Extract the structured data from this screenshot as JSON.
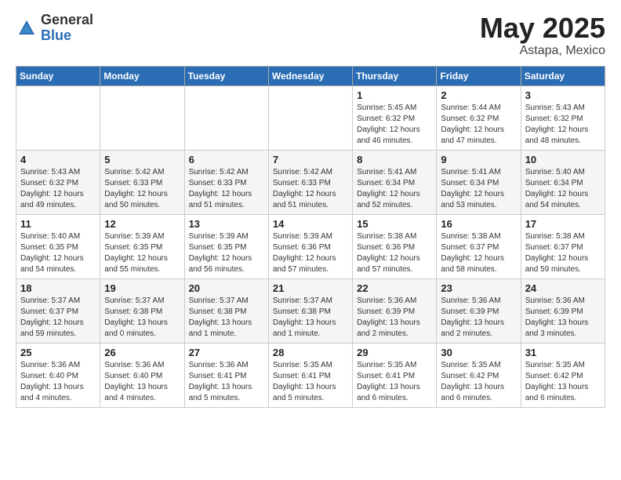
{
  "header": {
    "logo_general": "General",
    "logo_blue": "Blue",
    "month": "May 2025",
    "location": "Astapa, Mexico"
  },
  "days_of_week": [
    "Sunday",
    "Monday",
    "Tuesday",
    "Wednesday",
    "Thursday",
    "Friday",
    "Saturday"
  ],
  "weeks": [
    [
      {
        "day": "",
        "info": ""
      },
      {
        "day": "",
        "info": ""
      },
      {
        "day": "",
        "info": ""
      },
      {
        "day": "",
        "info": ""
      },
      {
        "day": "1",
        "info": "Sunrise: 5:45 AM\nSunset: 6:32 PM\nDaylight: 12 hours\nand 46 minutes."
      },
      {
        "day": "2",
        "info": "Sunrise: 5:44 AM\nSunset: 6:32 PM\nDaylight: 12 hours\nand 47 minutes."
      },
      {
        "day": "3",
        "info": "Sunrise: 5:43 AM\nSunset: 6:32 PM\nDaylight: 12 hours\nand 48 minutes."
      }
    ],
    [
      {
        "day": "4",
        "info": "Sunrise: 5:43 AM\nSunset: 6:32 PM\nDaylight: 12 hours\nand 49 minutes."
      },
      {
        "day": "5",
        "info": "Sunrise: 5:42 AM\nSunset: 6:33 PM\nDaylight: 12 hours\nand 50 minutes."
      },
      {
        "day": "6",
        "info": "Sunrise: 5:42 AM\nSunset: 6:33 PM\nDaylight: 12 hours\nand 51 minutes."
      },
      {
        "day": "7",
        "info": "Sunrise: 5:42 AM\nSunset: 6:33 PM\nDaylight: 12 hours\nand 51 minutes."
      },
      {
        "day": "8",
        "info": "Sunrise: 5:41 AM\nSunset: 6:34 PM\nDaylight: 12 hours\nand 52 minutes."
      },
      {
        "day": "9",
        "info": "Sunrise: 5:41 AM\nSunset: 6:34 PM\nDaylight: 12 hours\nand 53 minutes."
      },
      {
        "day": "10",
        "info": "Sunrise: 5:40 AM\nSunset: 6:34 PM\nDaylight: 12 hours\nand 54 minutes."
      }
    ],
    [
      {
        "day": "11",
        "info": "Sunrise: 5:40 AM\nSunset: 6:35 PM\nDaylight: 12 hours\nand 54 minutes."
      },
      {
        "day": "12",
        "info": "Sunrise: 5:39 AM\nSunset: 6:35 PM\nDaylight: 12 hours\nand 55 minutes."
      },
      {
        "day": "13",
        "info": "Sunrise: 5:39 AM\nSunset: 6:35 PM\nDaylight: 12 hours\nand 56 minutes."
      },
      {
        "day": "14",
        "info": "Sunrise: 5:39 AM\nSunset: 6:36 PM\nDaylight: 12 hours\nand 57 minutes."
      },
      {
        "day": "15",
        "info": "Sunrise: 5:38 AM\nSunset: 6:36 PM\nDaylight: 12 hours\nand 57 minutes."
      },
      {
        "day": "16",
        "info": "Sunrise: 5:38 AM\nSunset: 6:37 PM\nDaylight: 12 hours\nand 58 minutes."
      },
      {
        "day": "17",
        "info": "Sunrise: 5:38 AM\nSunset: 6:37 PM\nDaylight: 12 hours\nand 59 minutes."
      }
    ],
    [
      {
        "day": "18",
        "info": "Sunrise: 5:37 AM\nSunset: 6:37 PM\nDaylight: 12 hours\nand 59 minutes."
      },
      {
        "day": "19",
        "info": "Sunrise: 5:37 AM\nSunset: 6:38 PM\nDaylight: 13 hours\nand 0 minutes."
      },
      {
        "day": "20",
        "info": "Sunrise: 5:37 AM\nSunset: 6:38 PM\nDaylight: 13 hours\nand 1 minute."
      },
      {
        "day": "21",
        "info": "Sunrise: 5:37 AM\nSunset: 6:38 PM\nDaylight: 13 hours\nand 1 minute."
      },
      {
        "day": "22",
        "info": "Sunrise: 5:36 AM\nSunset: 6:39 PM\nDaylight: 13 hours\nand 2 minutes."
      },
      {
        "day": "23",
        "info": "Sunrise: 5:36 AM\nSunset: 6:39 PM\nDaylight: 13 hours\nand 2 minutes."
      },
      {
        "day": "24",
        "info": "Sunrise: 5:36 AM\nSunset: 6:39 PM\nDaylight: 13 hours\nand 3 minutes."
      }
    ],
    [
      {
        "day": "25",
        "info": "Sunrise: 5:36 AM\nSunset: 6:40 PM\nDaylight: 13 hours\nand 4 minutes."
      },
      {
        "day": "26",
        "info": "Sunrise: 5:36 AM\nSunset: 6:40 PM\nDaylight: 13 hours\nand 4 minutes."
      },
      {
        "day": "27",
        "info": "Sunrise: 5:36 AM\nSunset: 6:41 PM\nDaylight: 13 hours\nand 5 minutes."
      },
      {
        "day": "28",
        "info": "Sunrise: 5:35 AM\nSunset: 6:41 PM\nDaylight: 13 hours\nand 5 minutes."
      },
      {
        "day": "29",
        "info": "Sunrise: 5:35 AM\nSunset: 6:41 PM\nDaylight: 13 hours\nand 6 minutes."
      },
      {
        "day": "30",
        "info": "Sunrise: 5:35 AM\nSunset: 6:42 PM\nDaylight: 13 hours\nand 6 minutes."
      },
      {
        "day": "31",
        "info": "Sunrise: 5:35 AM\nSunset: 6:42 PM\nDaylight: 13 hours\nand 6 minutes."
      }
    ]
  ]
}
